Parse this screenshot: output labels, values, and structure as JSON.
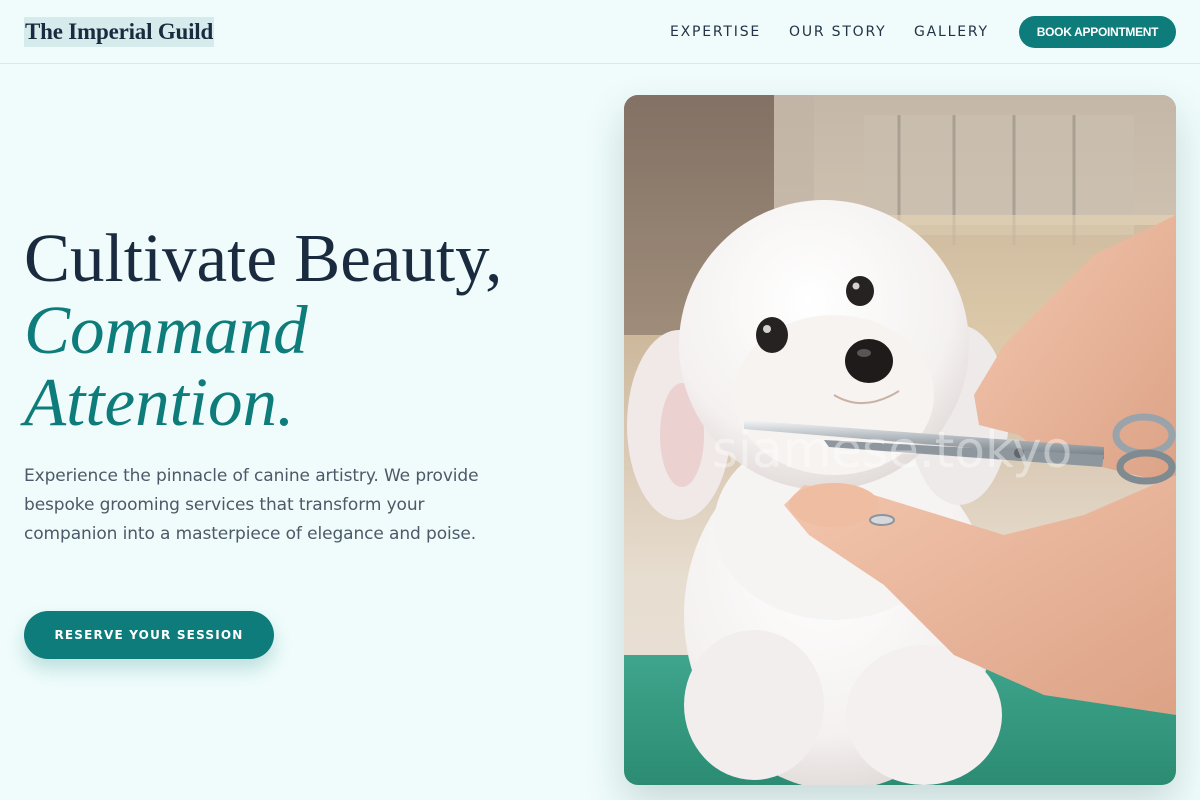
{
  "header": {
    "logo": "The Imperial Guild",
    "nav": [
      {
        "label": "EXPERTISE"
      },
      {
        "label": "OUR STORY"
      },
      {
        "label": "GALLERY"
      }
    ],
    "cta_label": "BOOK APPOINTMENT"
  },
  "hero": {
    "headline_line1": "Cultivate Beauty,",
    "headline_accent_line1": "Command",
    "headline_accent_line2": "Attention.",
    "lead": "Experience the pinnacle of canine artistry. We provide bespoke grooming services that transform your companion into a masterpiece of elegance and poise.",
    "cta_label": "RESERVE YOUR SESSION"
  },
  "image": {
    "watermark": "siamese.tokyo"
  },
  "colors": {
    "background": "#effcfb",
    "accent": "#0e7c7b",
    "heading": "#1b2b3f",
    "body_text": "#4c5968"
  }
}
